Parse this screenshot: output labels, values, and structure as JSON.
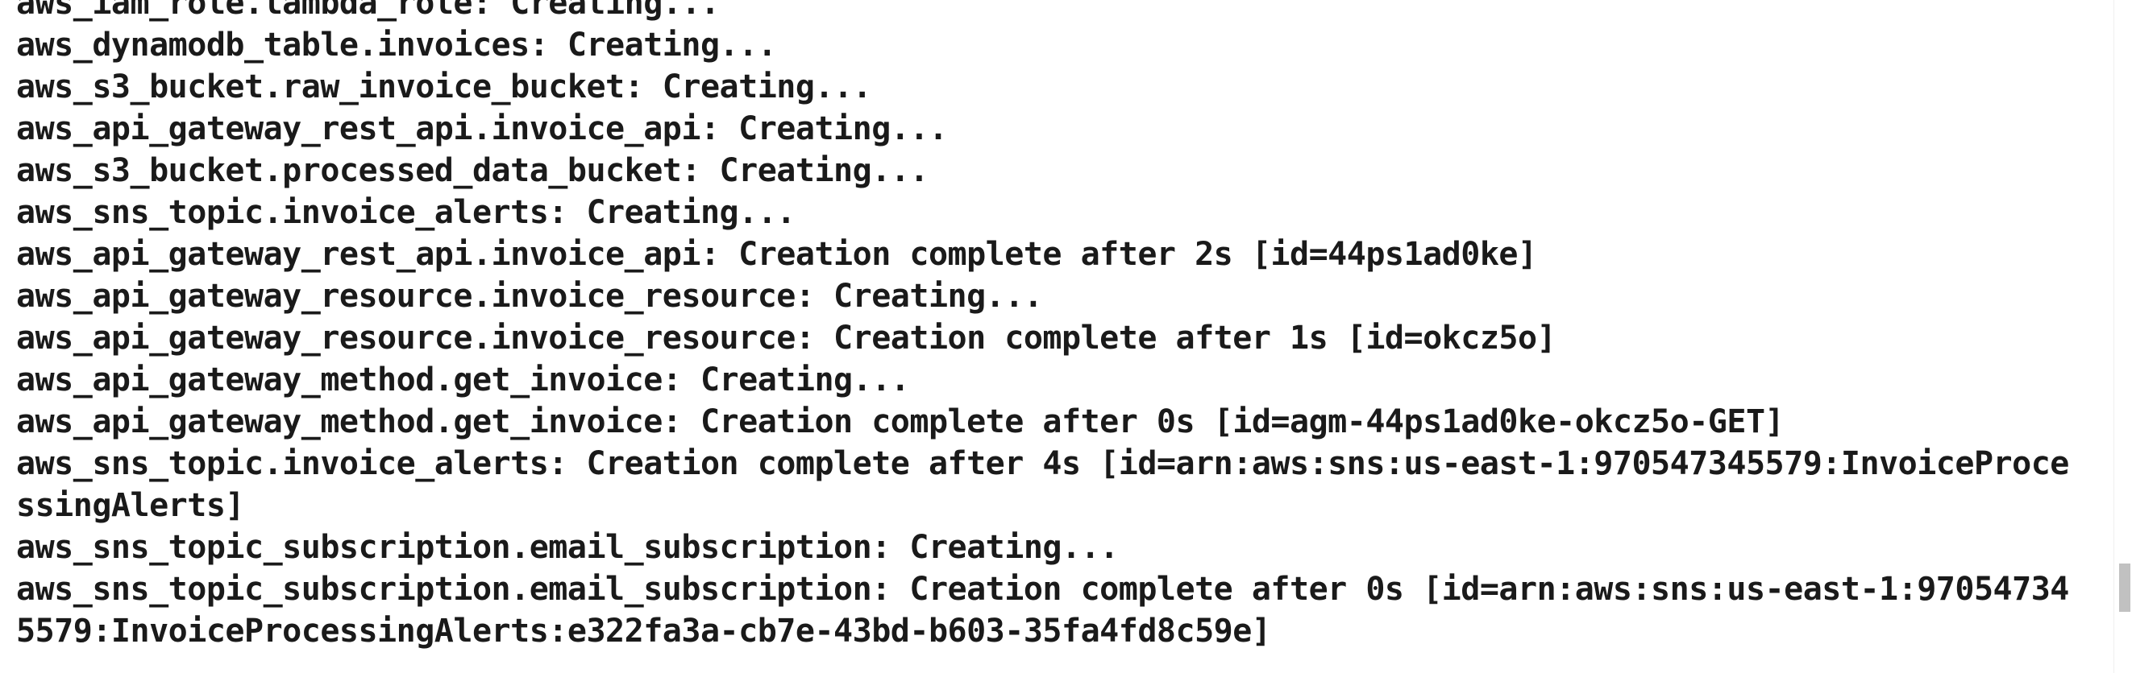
{
  "terminal": {
    "lines": [
      "aws_iam_role.lambda_role: Creating...",
      "aws_dynamodb_table.invoices: Creating...",
      "aws_s3_bucket.raw_invoice_bucket: Creating...",
      "aws_api_gateway_rest_api.invoice_api: Creating...",
      "aws_s3_bucket.processed_data_bucket: Creating...",
      "aws_sns_topic.invoice_alerts: Creating...",
      "aws_api_gateway_rest_api.invoice_api: Creation complete after 2s [id=44ps1ad0ke]",
      "aws_api_gateway_resource.invoice_resource: Creating...",
      "aws_api_gateway_resource.invoice_resource: Creation complete after 1s [id=okcz5o]",
      "aws_api_gateway_method.get_invoice: Creating...",
      "aws_api_gateway_method.get_invoice: Creation complete after 0s [id=agm-44ps1ad0ke-okcz5o-GET]",
      "aws_sns_topic.invoice_alerts: Creation complete after 4s [id=arn:aws:sns:us-east-1:970547345579:InvoiceProce",
      "ssingAlerts]",
      "aws_sns_topic_subscription.email_subscription: Creating...",
      "aws_sns_topic_subscription.email_subscription: Creation complete after 0s [id=arn:aws:sns:us-east-1:97054734",
      "5579:InvoiceProcessingAlerts:e322fa3a-cb7e-43bd-b603-35fa4fd8c59e]"
    ]
  },
  "colors": {
    "text": "#1a1a1a",
    "background": "#ffffff",
    "scrollbar_thumb": "#c1c1c1"
  }
}
